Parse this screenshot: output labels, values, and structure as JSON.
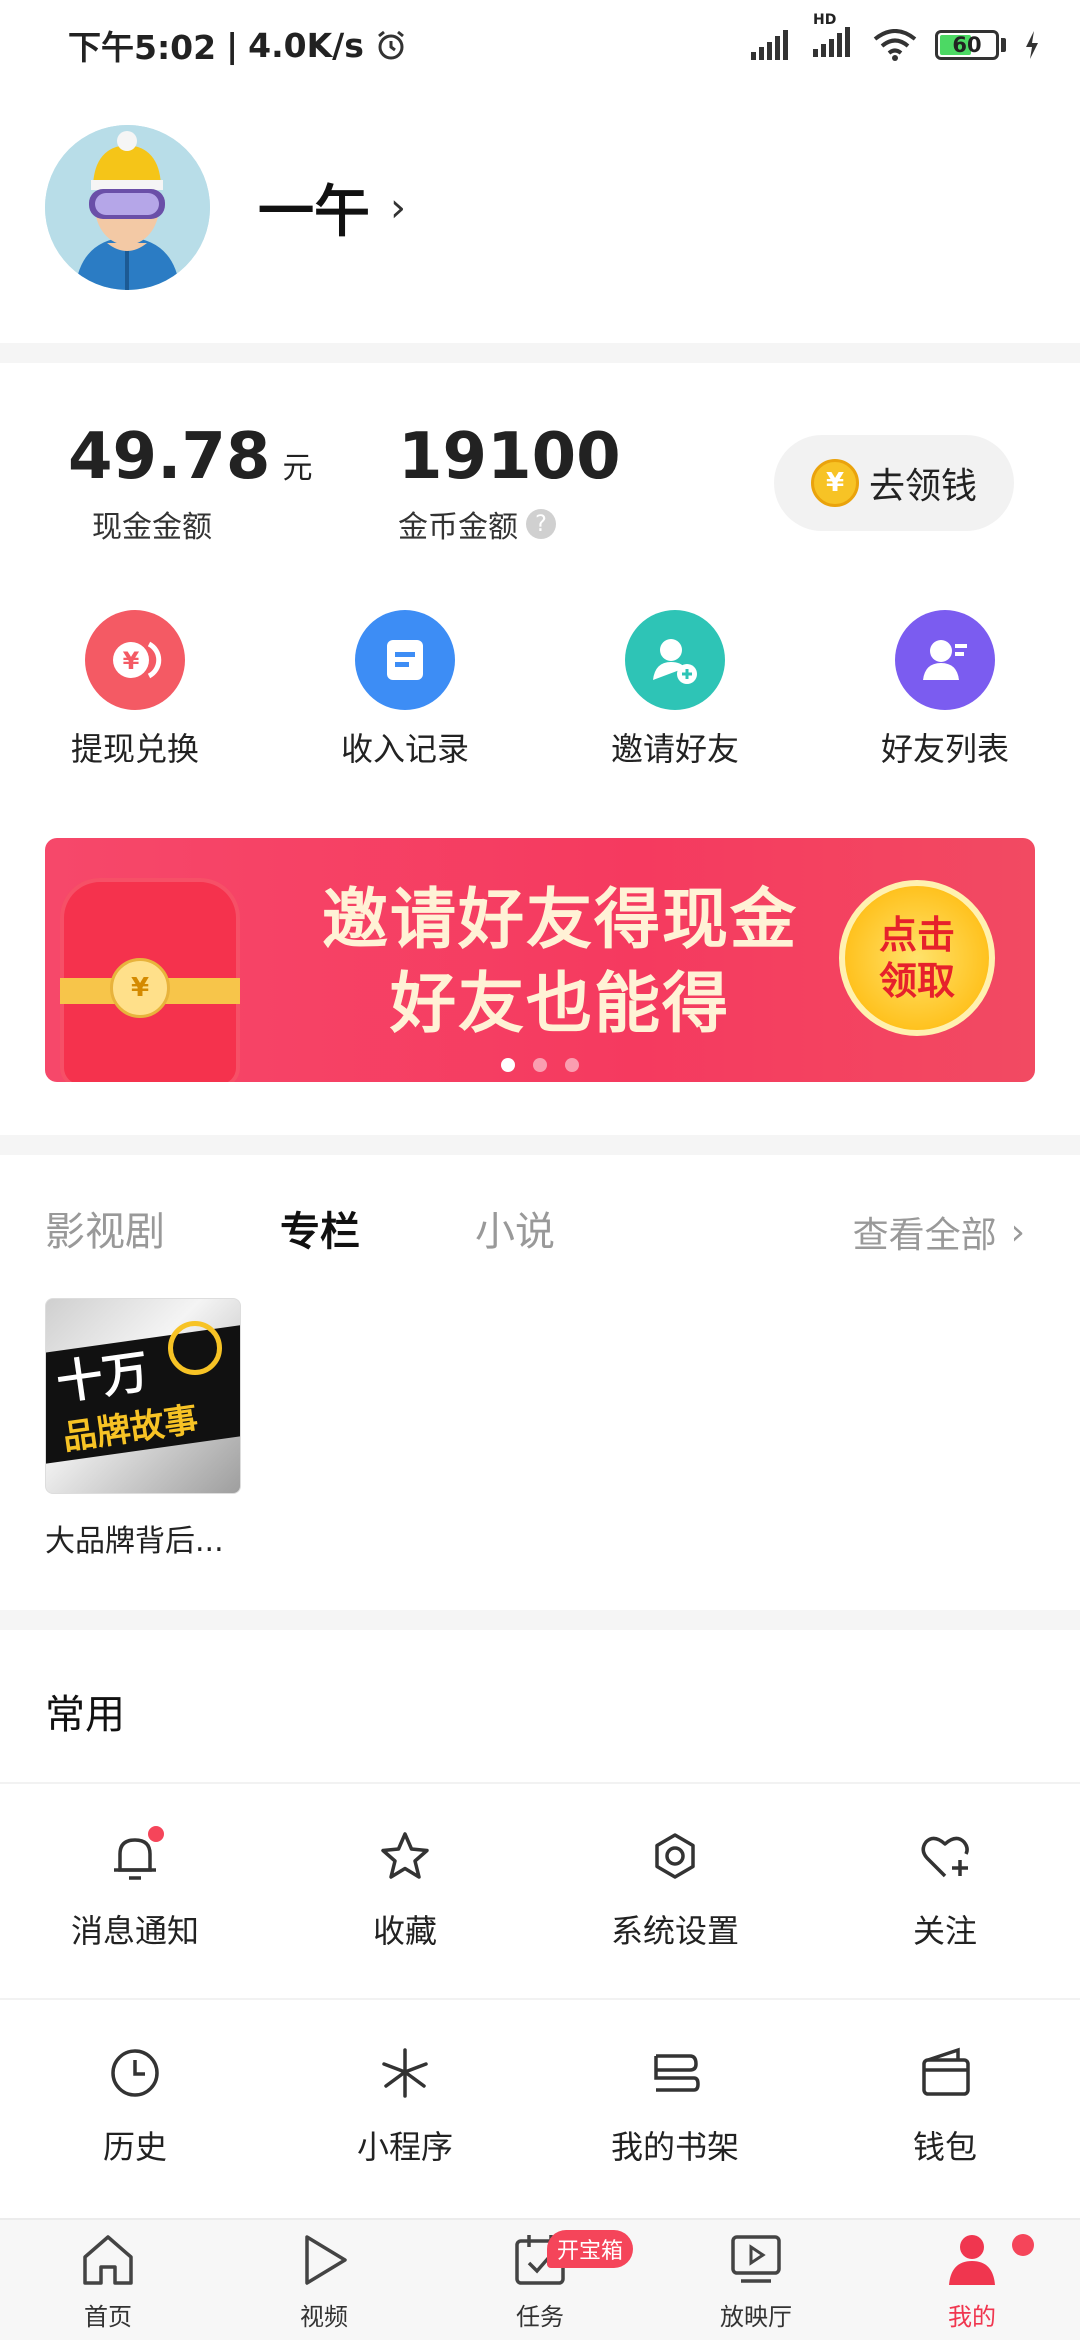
{
  "status_bar": {
    "time": "下午5:02",
    "speed": "4.0K/s",
    "battery": "60",
    "hd_label": "HD"
  },
  "profile": {
    "username": "一午"
  },
  "money": {
    "cash_value": "49.78",
    "cash_unit": "元",
    "cash_label": "现金金额",
    "coin_value": "19100",
    "coin_label": "金币金额",
    "get_money_label": "去领钱",
    "help_mark": "?"
  },
  "quick_actions": [
    {
      "label": "提现兑换",
      "color": "#f45a64"
    },
    {
      "label": "收入记录",
      "color": "#3d8df5"
    },
    {
      "label": "邀请好友",
      "color": "#2ec4b6"
    },
    {
      "label": "好友列表",
      "color": "#7b5cf0"
    }
  ],
  "banner": {
    "line1": "邀请好友得现金",
    "line2": "好友也能得",
    "button_line1": "点击",
    "button_line2": "领取",
    "page_count": 3,
    "active_page": 1
  },
  "content_tabs": {
    "tabs": [
      "影视剧",
      "专栏",
      "小说"
    ],
    "active": "专栏",
    "see_all": "查看全部"
  },
  "book": {
    "cover_line1": "十万",
    "cover_line2": "品牌故事",
    "title": "大品牌背后..."
  },
  "common": {
    "title": "常用",
    "row1": [
      {
        "label": "消息通知",
        "icon": "bell-icon"
      },
      {
        "label": "收藏",
        "icon": "star-icon"
      },
      {
        "label": "系统设置",
        "icon": "gear-icon"
      },
      {
        "label": "关注",
        "icon": "heart-plus-icon"
      }
    ],
    "row2": [
      {
        "label": "历史",
        "icon": "clock-icon"
      },
      {
        "label": "小程序",
        "icon": "miniprogram-icon"
      },
      {
        "label": "我的书架",
        "icon": "bookshelf-icon"
      },
      {
        "label": "钱包",
        "icon": "wallet-icon"
      }
    ]
  },
  "bottom_nav": {
    "items": [
      {
        "label": "首页",
        "icon": "home-icon"
      },
      {
        "label": "视频",
        "icon": "play-icon"
      },
      {
        "label": "任务",
        "icon": "task-icon"
      },
      {
        "label": "放映厅",
        "icon": "screening-icon"
      },
      {
        "label": "我的",
        "icon": "person-icon"
      }
    ],
    "active": "我的",
    "task_badge": "开宝箱"
  },
  "colors": {
    "accent_red": "#f0364f",
    "banner_red": "#f53a5f",
    "coin_gold": "#f7c325"
  }
}
